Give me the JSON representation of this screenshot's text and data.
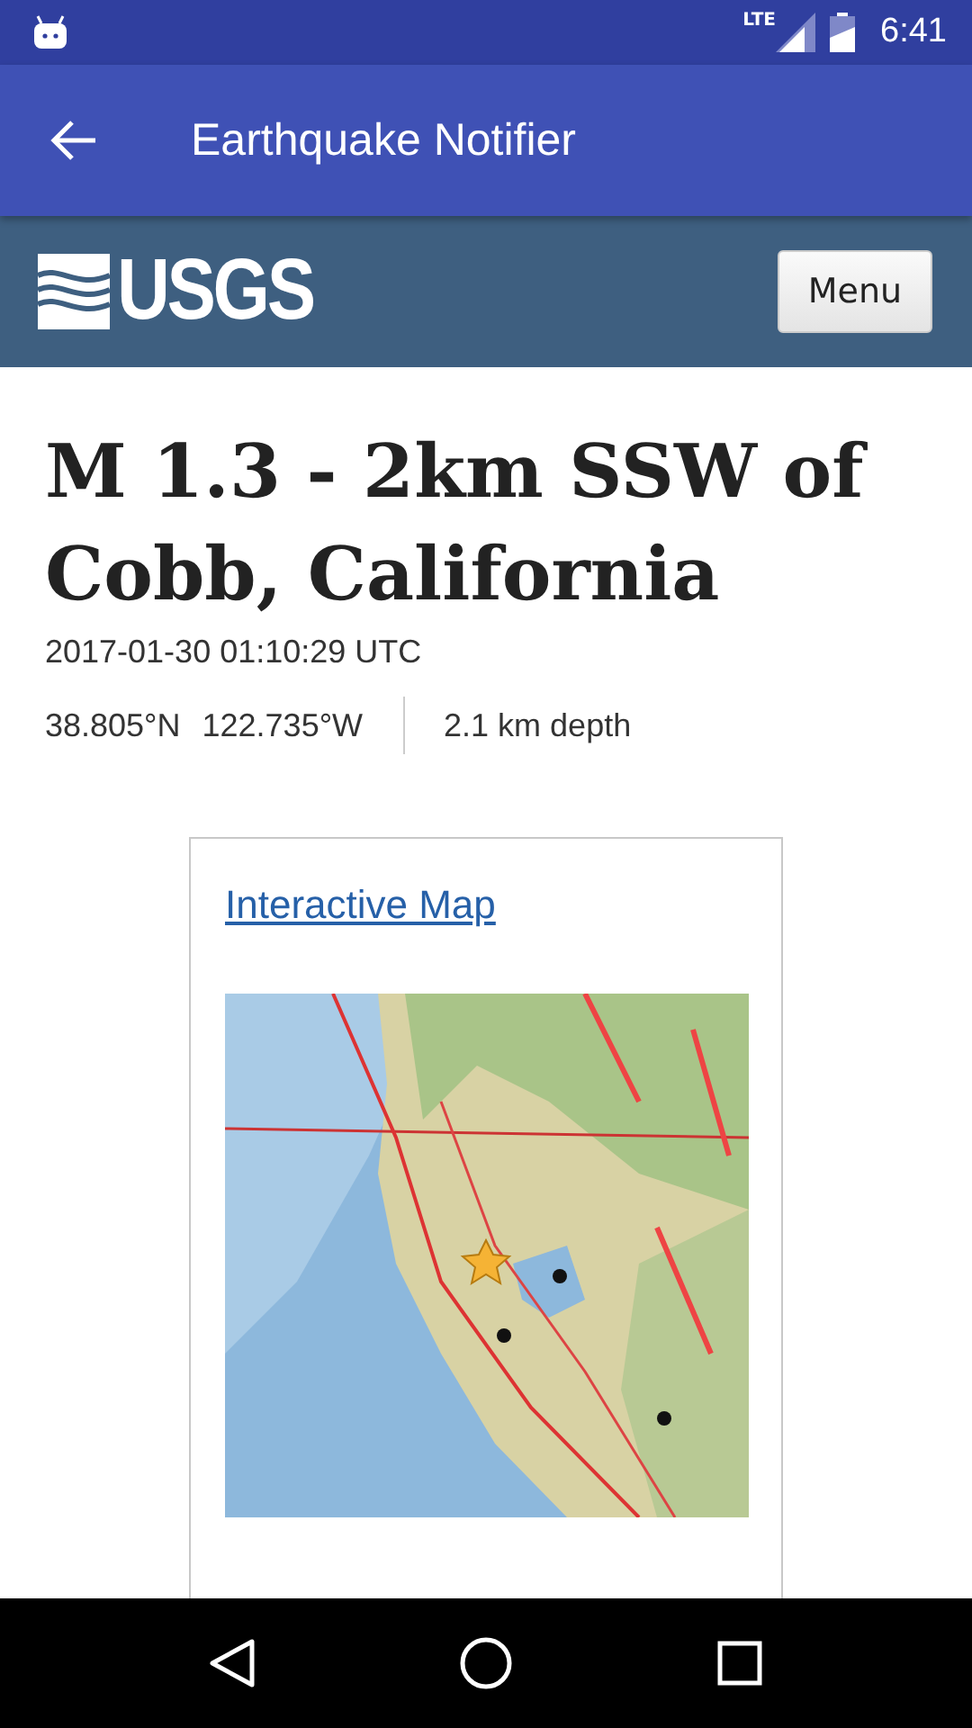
{
  "status_bar": {
    "network": "LTE",
    "time": "6:41"
  },
  "app_bar": {
    "title": "Earthquake Notifier"
  },
  "site_header": {
    "logo": "USGS",
    "menu_button": "Menu"
  },
  "event": {
    "title": "M 1.3 - 2km SSW of Cobb, California",
    "time": "2017-01-30 01:10:29 UTC",
    "latitude": "38.805°N",
    "longitude": "122.735°W",
    "depth": "2.1 km depth"
  },
  "map_card": {
    "link": "Interactive Map"
  }
}
